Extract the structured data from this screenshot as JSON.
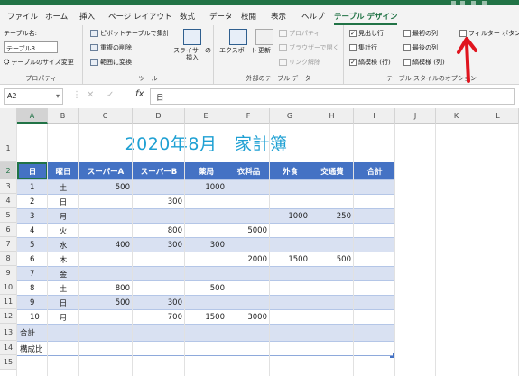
{
  "ribbon_tabs": [
    "ファイル",
    "ホーム",
    "挿入",
    "ページ レイアウト",
    "数式",
    "データ",
    "校閲",
    "表示",
    "ヘルプ",
    "テーブル デザイン"
  ],
  "properties": {
    "table_name_label": "テーブル名:",
    "table_name_value": "テーブル3",
    "resize_label": "テーブルのサイズ変更",
    "group_label": "プロパティ"
  },
  "tools": {
    "pivot_label": "ピボットテーブルで集計",
    "remove_dup_label": "重複の削除",
    "convert_label": "範囲に変換",
    "slicer_label1": "スライサーの",
    "slicer_label2": "挿入",
    "group_label": "ツール"
  },
  "external": {
    "export_label": "エクスポート",
    "refresh_label": "更新",
    "properties_label": "プロパティ",
    "browser_label": "ブラウザーで開く",
    "unlink_label": "リンク解除",
    "group_label": "外部のテーブル データ"
  },
  "style_options": {
    "header_row": {
      "label": "見出し行",
      "checked": true
    },
    "total_row": {
      "label": "集計行",
      "checked": false
    },
    "banded_rows": {
      "label": "縞模様 (行)",
      "checked": true
    },
    "first_column": {
      "label": "最初の列",
      "checked": false
    },
    "last_column": {
      "label": "最後の列",
      "checked": false
    },
    "banded_columns": {
      "label": "縞模様 (列)",
      "checked": false
    },
    "filter_button": {
      "label": "フィルター ボタン",
      "checked": false
    },
    "group_label": "テーブル スタイルのオプション"
  },
  "formula_bar": {
    "name_box": "A2",
    "fx": "fx",
    "content": "日"
  },
  "columns": [
    "A",
    "B",
    "C",
    "D",
    "E",
    "F",
    "G",
    "H",
    "I",
    "J",
    "K",
    "L"
  ],
  "sheet_title": "2020年8月　家計簿",
  "table_headers": [
    "日",
    "曜日",
    "スーパーA",
    "スーパーB",
    "薬局",
    "衣料品",
    "外食",
    "交通費",
    "合計"
  ],
  "rows": [
    {
      "rownum": "1",
      "cells": [
        "",
        "",
        "",
        "",
        "",
        "",
        "",
        "",
        ""
      ]
    },
    {
      "rownum": "2",
      "cells": [
        "日",
        "曜日",
        "スーパーA",
        "スーパーB",
        "薬局",
        "衣料品",
        "外食",
        "交通費",
        "合計"
      ]
    },
    {
      "rownum": "3",
      "cells": [
        "1",
        "土",
        "500",
        "",
        "1000",
        "",
        "",
        "",
        ""
      ]
    },
    {
      "rownum": "4",
      "cells": [
        "2",
        "日",
        "",
        "300",
        "",
        "",
        "",
        "",
        ""
      ]
    },
    {
      "rownum": "5",
      "cells": [
        "3",
        "月",
        "",
        "",
        "",
        "",
        "1000",
        "250",
        ""
      ]
    },
    {
      "rownum": "6",
      "cells": [
        "4",
        "火",
        "",
        "800",
        "",
        "5000",
        "",
        "",
        ""
      ]
    },
    {
      "rownum": "7",
      "cells": [
        "5",
        "水",
        "400",
        "300",
        "300",
        "",
        "",
        "",
        ""
      ]
    },
    {
      "rownum": "8",
      "cells": [
        "6",
        "木",
        "",
        "",
        "",
        "2000",
        "1500",
        "500",
        ""
      ]
    },
    {
      "rownum": "9",
      "cells": [
        "7",
        "金",
        "",
        "",
        "",
        "",
        "",
        "",
        ""
      ]
    },
    {
      "rownum": "10",
      "cells": [
        "8",
        "土",
        "800",
        "",
        "500",
        "",
        "",
        "",
        ""
      ]
    },
    {
      "rownum": "11",
      "cells": [
        "9",
        "日",
        "500",
        "300",
        "",
        "",
        "",
        "",
        ""
      ]
    },
    {
      "rownum": "12",
      "cells": [
        "10",
        "月",
        "",
        "700",
        "1500",
        "3000",
        "",
        "",
        ""
      ]
    },
    {
      "rownum": "13",
      "cells": [
        "合計",
        "",
        "",
        "",
        "",
        "",
        "",
        "",
        ""
      ]
    },
    {
      "rownum": "14",
      "cells": [
        "構成比",
        "",
        "",
        "",
        "",
        "",
        "",
        "",
        ""
      ]
    },
    {
      "rownum": "15",
      "cells": [
        "",
        "",
        "",
        "",
        "",
        "",
        "",
        "",
        ""
      ]
    }
  ],
  "colors": {
    "accent": "#217346",
    "header_fill": "#4472c4",
    "band_fill": "#d9e1f2",
    "title_color": "#1ea0d3",
    "annotation": "#e0141e"
  }
}
